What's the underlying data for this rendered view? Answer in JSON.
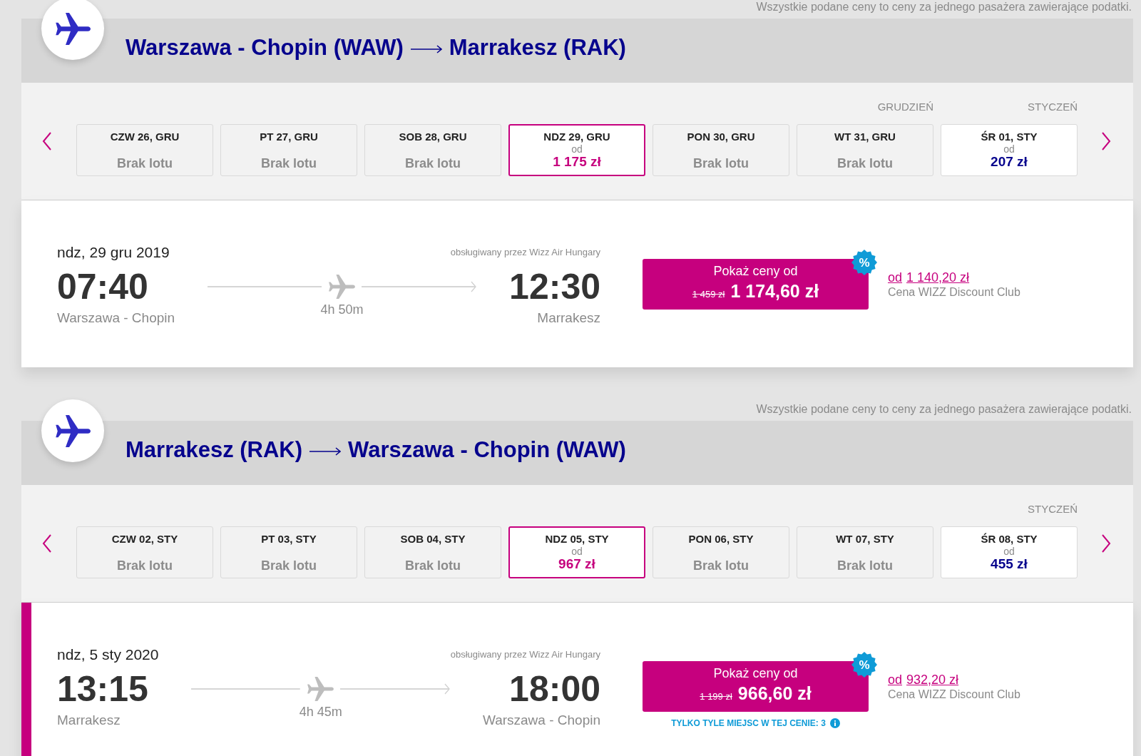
{
  "legs": [
    {
      "note": "Wszystkie podane ceny to ceny za jednego pasażera zawierające podatki.",
      "route": {
        "origin": "Warszawa - Chopin (WAW)",
        "destination": "Marrakesz (RAK)"
      },
      "days": [
        {
          "kind": "no_flight",
          "label": "CZW 26, GRU",
          "status": "Brak lotu",
          "selected": false
        },
        {
          "kind": "no_flight",
          "label": "PT 27, GRU",
          "status": "Brak lotu",
          "selected": false
        },
        {
          "kind": "no_flight",
          "label": "SOB 28, GRU",
          "status": "Brak lotu",
          "selected": false
        },
        {
          "kind": "fare",
          "label": "NDZ 29, GRU",
          "from": "od",
          "price": "1 175 zł",
          "selected": true
        },
        {
          "kind": "no_flight",
          "label": "PON 30, GRU",
          "status": "Brak lotu",
          "selected": false
        },
        {
          "kind": "no_flight",
          "label": "WT 31, GRU",
          "status": "Brak lotu",
          "selected": false,
          "month": "GRUDZIEŃ"
        },
        {
          "kind": "fare",
          "label": "ŚR 01, STY",
          "from": "od",
          "price": "207 zł",
          "selected": false,
          "month": "STYCZEŃ"
        }
      ],
      "flight": {
        "selected": false,
        "date": "ndz, 29 gru 2019",
        "departure": "07:40",
        "origin": "Warszawa - Chopin",
        "duration": "4h 50m",
        "operator": "obsługiwany przez Wizz Air Hungary",
        "arrival": "12:30",
        "destination": "Marrakesz",
        "price_button": {
          "label": "Pokaż ceny od",
          "old_price": "1 459 zł",
          "price": "1 174,60 zł",
          "badge": "%"
        },
        "discount": {
          "from": "od",
          "price": "1 140,20 zł",
          "caption": "Cena WIZZ Discount Club"
        }
      }
    },
    {
      "note": "Wszystkie podane ceny to ceny za jednego pasażera zawierające podatki.",
      "route": {
        "origin": "Marrakesz (RAK)",
        "destination": "Warszawa - Chopin (WAW)"
      },
      "days": [
        {
          "kind": "no_flight",
          "label": "CZW 02, STY",
          "status": "Brak lotu",
          "selected": false
        },
        {
          "kind": "no_flight",
          "label": "PT 03, STY",
          "status": "Brak lotu",
          "selected": false
        },
        {
          "kind": "no_flight",
          "label": "SOB 04, STY",
          "status": "Brak lotu",
          "selected": false
        },
        {
          "kind": "fare",
          "label": "NDZ 05, STY",
          "from": "od",
          "price": "967 zł",
          "selected": true
        },
        {
          "kind": "no_flight",
          "label": "PON 06, STY",
          "status": "Brak lotu",
          "selected": false
        },
        {
          "kind": "no_flight",
          "label": "WT 07, STY",
          "status": "Brak lotu",
          "selected": false
        },
        {
          "kind": "fare",
          "label": "ŚR 08, STY",
          "from": "od",
          "price": "455 zł",
          "selected": false,
          "month": "STYCZEŃ"
        }
      ],
      "flight": {
        "selected": true,
        "date": "ndz, 5 sty 2020",
        "departure": "13:15",
        "origin": "Marrakesz",
        "duration": "4h 45m",
        "operator": "obsługiwany przez Wizz Air Hungary",
        "arrival": "18:00",
        "destination": "Warszawa - Chopin",
        "price_button": {
          "label": "Pokaż ceny od",
          "old_price": "1 199 zł",
          "price": "966,60 zł",
          "badge": "%"
        },
        "discount": {
          "from": "od",
          "price": "932,20 zł",
          "caption": "Cena WIZZ Discount Club"
        },
        "seats_note": "TYLKO TYLE MIEJSC W TEJ CENIE: 3"
      }
    }
  ]
}
